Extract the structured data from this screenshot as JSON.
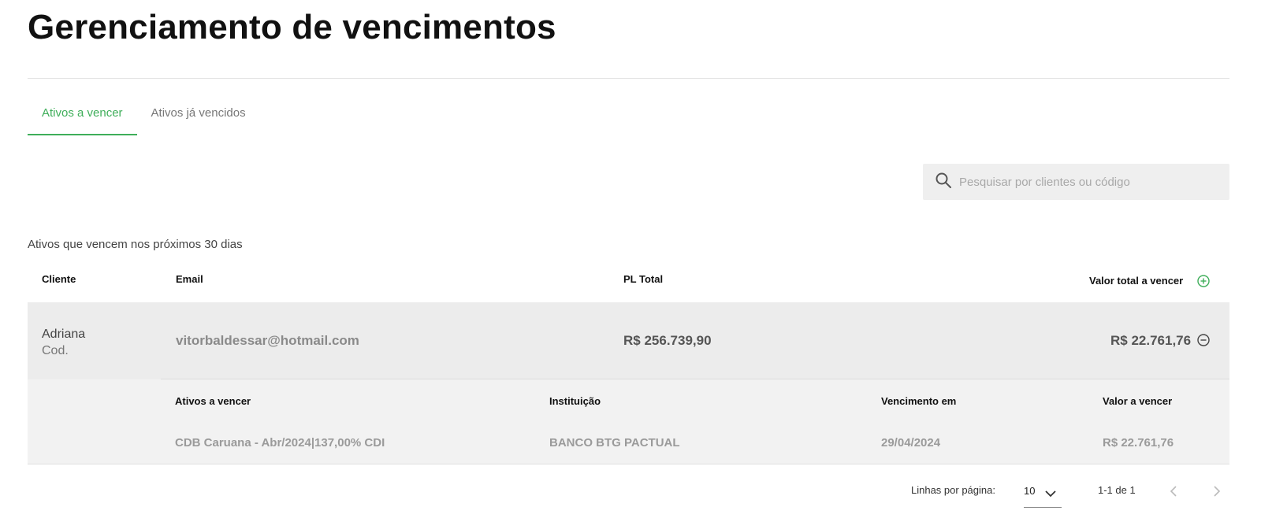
{
  "page": {
    "title": "Gerenciamento de vencimentos"
  },
  "tabs": [
    {
      "label": "Ativos a vencer",
      "active": true
    },
    {
      "label": "Ativos já vencidos",
      "active": false
    }
  ],
  "search": {
    "placeholder": "Pesquisar por clientes ou código",
    "value": ""
  },
  "section": {
    "label": "Ativos que vencem nos próximos 30 dias"
  },
  "table": {
    "columns": [
      "Cliente",
      "Email",
      "PL Total",
      "Valor total a vencer"
    ],
    "rows": [
      {
        "client_name": "Adriana",
        "client_code": "Cod.",
        "email": "vitorbaldessar@hotmail.com",
        "pl_total": "R$ 256.739,90",
        "valor_total": "R$ 22.761,76",
        "expanded": true,
        "details": {
          "columns": [
            "Ativos a vencer",
            "Instituição",
            "Vencimento em",
            "Valor a vencer"
          ],
          "items": [
            {
              "ativo": "CDB Caruana - Abr/2024|137,00% CDI",
              "instituicao": "BANCO BTG PACTUAL",
              "vencimento": "29/04/2024",
              "valor": "R$ 22.761,76"
            }
          ]
        }
      }
    ]
  },
  "pagination": {
    "rows_per_page_label": "Linhas por página:",
    "rows_per_page": "10",
    "range": "1-1 de 1"
  },
  "colors": {
    "accent": "#3fae5a",
    "row_bg": "#ececec",
    "subpanel_bg": "#f2f2f2"
  },
  "icons": [
    "search-icon",
    "plus-circle-icon",
    "minus-circle-icon",
    "chevron-down-icon",
    "chevron-left-icon",
    "chevron-right-icon"
  ]
}
